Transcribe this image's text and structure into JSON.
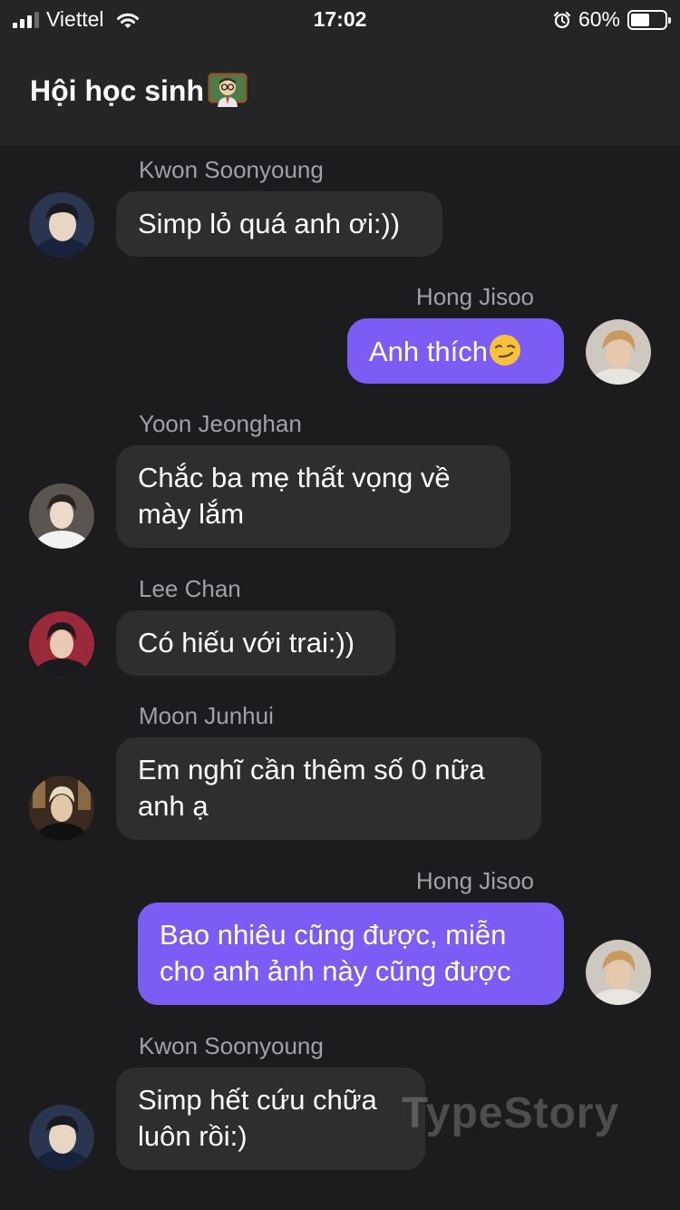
{
  "status_bar": {
    "carrier": "Viettel",
    "time": "17:02",
    "battery_percent": "60%",
    "battery_level": 0.6
  },
  "header": {
    "title": "Hội học sinh"
  },
  "messages": [
    {
      "sender": "Kwon Soonyoung",
      "direction": "incoming",
      "text": "Simp lỏ quá anh ơi:))"
    },
    {
      "sender": "Hong Jisoo",
      "direction": "outgoing",
      "text": "Anh thích",
      "emoji": "smirk-emoji"
    },
    {
      "sender": "Yoon Jeonghan",
      "direction": "incoming",
      "lines": [
        "Chắc ba mẹ thất vọng về",
        "mày lắm"
      ]
    },
    {
      "sender": "Lee Chan",
      "direction": "incoming",
      "text": "Có hiếu với trai:))"
    },
    {
      "sender": "Moon Junhui",
      "direction": "incoming",
      "lines": [
        "Em nghĩ cần thêm số 0 nữa",
        "anh ạ"
      ]
    },
    {
      "sender": "Hong Jisoo",
      "direction": "outgoing",
      "lines": [
        "Bao nhiêu cũng được, miễn",
        "cho anh ảnh này cũng được"
      ]
    },
    {
      "sender": "Kwon Soonyoung",
      "direction": "incoming",
      "lines": [
        "Simp hết cứu chữa",
        "luôn rồi:)"
      ]
    }
  ],
  "watermark": "TypeStory",
  "colors": {
    "background": "#1c1c1e",
    "header": "#252527",
    "incoming_bubble": "#2e2e31",
    "outgoing_bubble": "#7b5cf5",
    "sender_name": "#a1a1a6"
  }
}
